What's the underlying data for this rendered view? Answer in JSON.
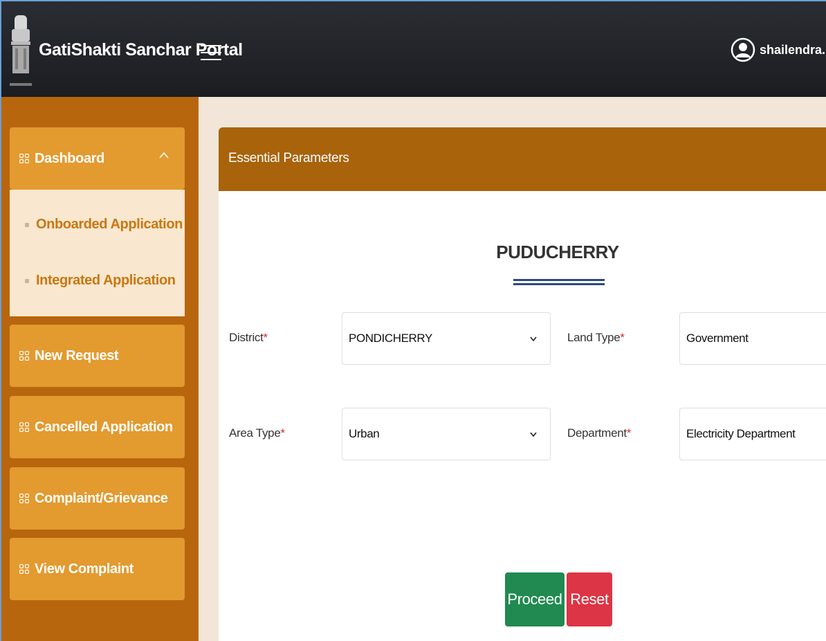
{
  "header": {
    "brand": "GatiShakti Sanchar Portal",
    "user": "shailendra.mps"
  },
  "sidebar": {
    "dashboard": "Dashboard",
    "submenu": [
      "Onboarded Application",
      "Integrated Application"
    ],
    "items": [
      "New Request",
      "Cancelled Application",
      "Complaint/Grievance",
      "View Complaint"
    ]
  },
  "card": {
    "title": "Essential Parameters",
    "state": "PUDUCHERRY"
  },
  "form": {
    "district_label": "District",
    "district_value": "PONDICHERRY",
    "land_type_label": "Land Type",
    "land_type_value": "Government",
    "area_type_label": "Area Type",
    "area_type_value": "Urban",
    "department_label": "Department",
    "department_value": "Electricity Department",
    "required_mark": "*"
  },
  "buttons": {
    "proceed": "Proceed",
    "reset": "Reset"
  },
  "colors": {
    "header_bg": "#1b1d21",
    "sidebar_bg": "#b8660e",
    "nav_item_bg": "#e39a2f",
    "card_head_bg": "#a8630b",
    "proceed_bg": "#208a50",
    "reset_bg": "#dc3545"
  }
}
